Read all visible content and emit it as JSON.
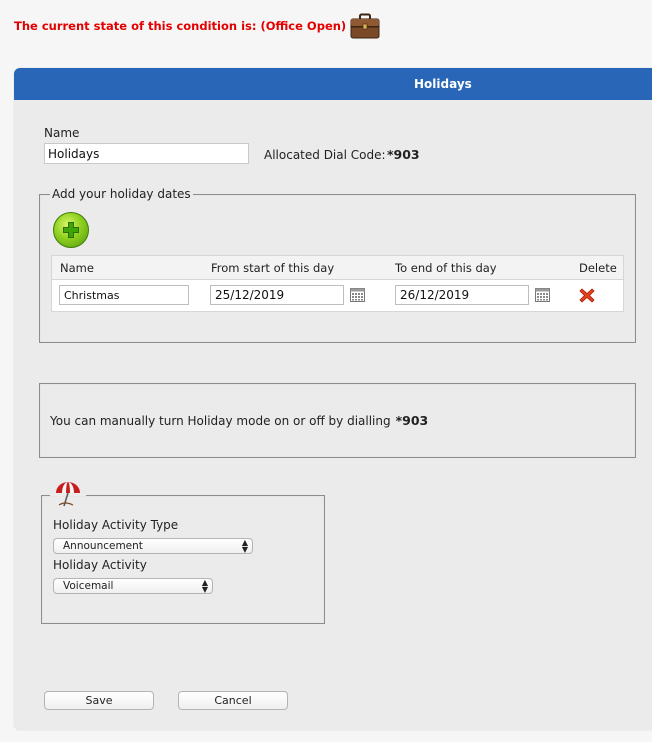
{
  "status": {
    "text": "The current state of this condition is: (Office Open)",
    "icon": "briefcase-icon"
  },
  "panel": {
    "title": "Holidays"
  },
  "name_field": {
    "label": "Name",
    "value": "Holidays"
  },
  "dial_code": {
    "label": "Allocated Dial Code:",
    "value": "*903"
  },
  "holiday_dates": {
    "legend": "Add your holiday dates",
    "add_icon": "add-plus-icon",
    "columns": {
      "name": "Name",
      "from": "From start of this day",
      "to": "To end of this day",
      "delete": "Delete"
    },
    "rows": [
      {
        "name": "Christmas",
        "from": "25/12/2019",
        "to": "26/12/2019"
      }
    ]
  },
  "manual_info": {
    "text": "You can manually turn Holiday mode on or off by dialling",
    "code": "*903"
  },
  "activity": {
    "legend_icon": "beach-umbrella-icon",
    "type_label": "Holiday Activity Type",
    "type_value": "Announcement",
    "activity_label": "Holiday Activity",
    "activity_value": "Voicemail"
  },
  "buttons": {
    "save": "Save",
    "cancel": "Cancel"
  },
  "colors": {
    "header_bg": "#2966b8",
    "status_text": "#e30000"
  }
}
